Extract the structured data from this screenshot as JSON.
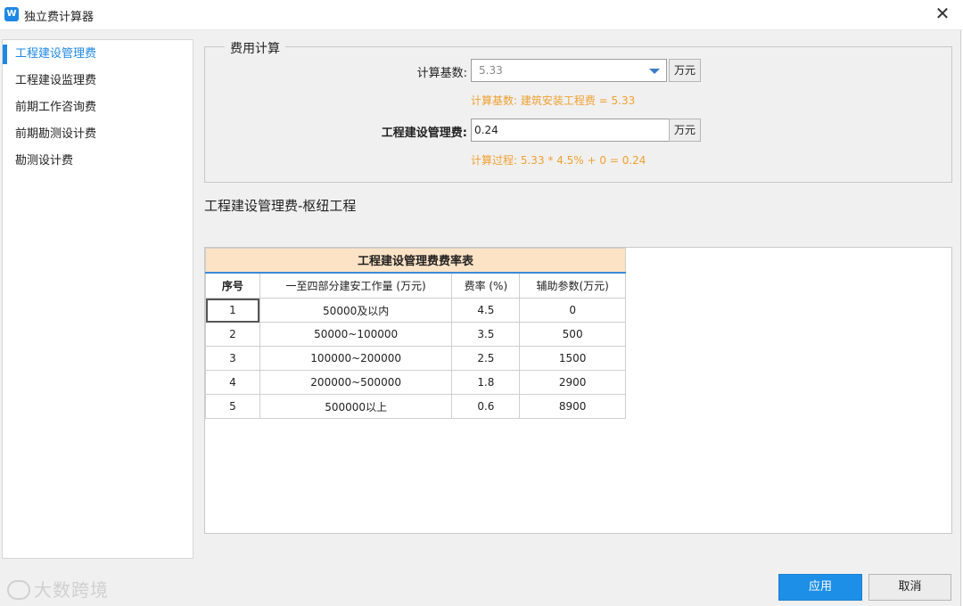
{
  "window": {
    "title": "独立费计算器",
    "app_icon_glyph": "W"
  },
  "sidebar": {
    "items": [
      {
        "label": "工程建设管理费",
        "active": true
      },
      {
        "label": "工程建设监理费",
        "active": false
      },
      {
        "label": "前期工作咨询费",
        "active": false
      },
      {
        "label": "前期勘测设计费",
        "active": false
      },
      {
        "label": "勘测设计费",
        "active": false
      }
    ]
  },
  "fee_calc": {
    "group_title": "费用计算",
    "base_label": "计算基数:",
    "base_value": "5.33",
    "base_unit": "万元",
    "base_note": "计算基数:  建筑安装工程费 = 5.33",
    "fee_label": "工程建设管理费:",
    "fee_value": "0.24",
    "fee_unit": "万元",
    "fee_note": "计算过程:  5.33 * 4.5% + 0 = 0.24"
  },
  "section_title": "工程建设管理费-枢纽工程",
  "rate_table": {
    "caption": "工程建设管理费费率表",
    "headers": [
      "序号",
      "一至四部分建安工作量 (万元)",
      "费率 (%)",
      "辅助参数(万元)"
    ],
    "rows": [
      [
        "1",
        "50000及以内",
        "4.5",
        "0"
      ],
      [
        "2",
        "50000~100000",
        "3.5",
        "500"
      ],
      [
        "3",
        "100000~200000",
        "2.5",
        "1500"
      ],
      [
        "4",
        "200000~500000",
        "1.8",
        "2900"
      ],
      [
        "5",
        "500000以上",
        "0.6",
        "8900"
      ]
    ]
  },
  "buttons": {
    "apply": "应用",
    "cancel": "取消"
  },
  "watermark": "大数跨境",
  "colors": {
    "accent": "#1e88e5",
    "note": "#f0a030",
    "table_header": "#fde3c6"
  }
}
